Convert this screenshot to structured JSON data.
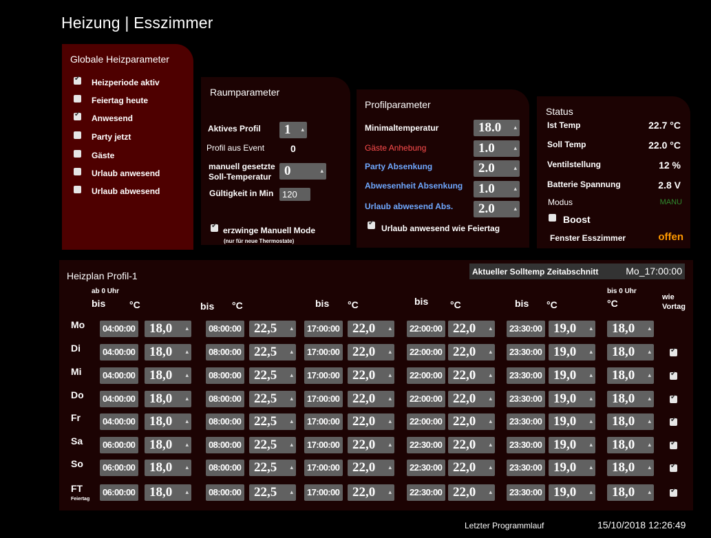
{
  "title": "Heizung | Esszimmer",
  "global": {
    "title": "Globale Heizparameter",
    "items": [
      {
        "label": "Heizperiode aktiv",
        "checked": true
      },
      {
        "label": "Feiertag heute",
        "checked": false
      },
      {
        "label": "Anwesend",
        "checked": true
      },
      {
        "label": "Party jetzt",
        "checked": false
      },
      {
        "label": "Gäste",
        "checked": false
      },
      {
        "label": "Urlaub anwesend",
        "checked": false
      },
      {
        "label": "Urlaub abwesend",
        "checked": false
      }
    ]
  },
  "room": {
    "title": "Raumparameter",
    "active_profile_label": "Aktives Profil",
    "active_profile_value": "1",
    "event_profile_label": "Profil aus Event",
    "event_profile_value": "0",
    "manual_label_1": "manuell gesetzte",
    "manual_label_2": "Soll-Temperatur",
    "manual_value": "0",
    "validity_label": "Gültigkeit in Min",
    "validity_value": "120",
    "force_manual_label": "erzwinge Manuell Mode",
    "force_manual_note": "(nur für neue Thermostate)",
    "force_manual_checked": true
  },
  "profile": {
    "title": "Profilparameter",
    "min_temp_label": "Minimaltemperatur",
    "min_temp_value": "18.0",
    "guest_label": "Gäste Anhebung",
    "guest_value": "1.0",
    "party_label": "Party Absenkung",
    "party_value": "2.0",
    "absent_label": "Abwesenheit Absenkung",
    "absent_value": "1.0",
    "vacation_label": "Urlaub abwesend Abs.",
    "vacation_value": "2.0",
    "vacation_holiday_label": "Urlaub anwesend wie Feiertag",
    "vacation_holiday_checked": true,
    "colors": {
      "guest": "#ff4d4d",
      "party": "#6fa8ff",
      "absent": "#6fa8ff",
      "vacation": "#6fa8ff"
    }
  },
  "status": {
    "title": "Status",
    "ist_temp_label": "Ist Temp",
    "ist_temp_value": "22.7 °C",
    "soll_temp_label": "Soll Temp",
    "soll_temp_value": "22.0 °C",
    "valve_label": "Ventilstellung",
    "valve_value": "12 %",
    "battery_label": "Batterie Spannung",
    "battery_value": "2.8 V",
    "mode_label": "Modus",
    "mode_value": "MANU",
    "boost_label": "Boost",
    "boost_checked": false,
    "window_label": "Fenster Esszimmer",
    "window_value": "offen",
    "colors": {
      "mode": "#2e8b2e",
      "window": "#ff9900"
    }
  },
  "plan": {
    "title": "Heizplan Profil-1",
    "current_label": "Aktueller Solltemp Zeitabschnitt",
    "current_value": "Mo_17:00:00",
    "col_ab0": "ab 0 Uhr",
    "col_bis": "bis",
    "col_deg": "°C",
    "col_bis0": "bis 0 Uhr",
    "col_wie_1": "wie",
    "col_wie_2": "Vortag",
    "rows": [
      {
        "day": "Mo",
        "sub": "",
        "t": [
          "04:00:00",
          "08:00:00",
          "17:00:00",
          "22:00:00",
          "23:30:00"
        ],
        "v": [
          "18,0",
          "22,5",
          "22,0",
          "22,0",
          "19,0",
          "18,0"
        ],
        "wie": null
      },
      {
        "day": "Di",
        "sub": "",
        "t": [
          "04:00:00",
          "08:00:00",
          "17:00:00",
          "22:00:00",
          "23:30:00"
        ],
        "v": [
          "18,0",
          "22,5",
          "22,0",
          "22,0",
          "19,0",
          "18,0"
        ],
        "wie": true
      },
      {
        "day": "Mi",
        "sub": "",
        "t": [
          "04:00:00",
          "08:00:00",
          "17:00:00",
          "22:00:00",
          "23:30:00"
        ],
        "v": [
          "18,0",
          "22,5",
          "22,0",
          "22,0",
          "19,0",
          "18,0"
        ],
        "wie": true
      },
      {
        "day": "Do",
        "sub": "",
        "t": [
          "04:00:00",
          "08:00:00",
          "17:00:00",
          "22:00:00",
          "23:30:00"
        ],
        "v": [
          "18,0",
          "22,5",
          "22,0",
          "22,0",
          "19,0",
          "18,0"
        ],
        "wie": true
      },
      {
        "day": "Fr",
        "sub": "",
        "t": [
          "04:00:00",
          "08:00:00",
          "17:00:00",
          "22:00:00",
          "23:30:00"
        ],
        "v": [
          "18,0",
          "22,5",
          "22,0",
          "22,0",
          "19,0",
          "18,0"
        ],
        "wie": true
      },
      {
        "day": "Sa",
        "sub": "",
        "t": [
          "06:00:00",
          "08:00:00",
          "17:00:00",
          "22:30:00",
          "23:30:00"
        ],
        "v": [
          "18,0",
          "22,5",
          "22,0",
          "22,0",
          "19,0",
          "18,0"
        ],
        "wie": true
      },
      {
        "day": "So",
        "sub": "",
        "t": [
          "06:00:00",
          "08:00:00",
          "17:00:00",
          "22:30:00",
          "23:30:00"
        ],
        "v": [
          "18,0",
          "22,5",
          "22,0",
          "22,0",
          "19,0",
          "18,0"
        ],
        "wie": true
      },
      {
        "day": "FT",
        "sub": "Feiertag",
        "t": [
          "06:00:00",
          "08:00:00",
          "17:00:00",
          "22:30:00",
          "23:30:00"
        ],
        "v": [
          "18,0",
          "22,5",
          "22,0",
          "22,0",
          "19,0",
          "18,0"
        ],
        "wie": true
      }
    ]
  },
  "footer": {
    "last_run_label": "Letzter Programmlauf",
    "last_run_value": "15/10/2018 12:26:49"
  },
  "icons": {
    "spinner": "spinner-arrows-icon",
    "checkbox": "checkbox-icon"
  }
}
